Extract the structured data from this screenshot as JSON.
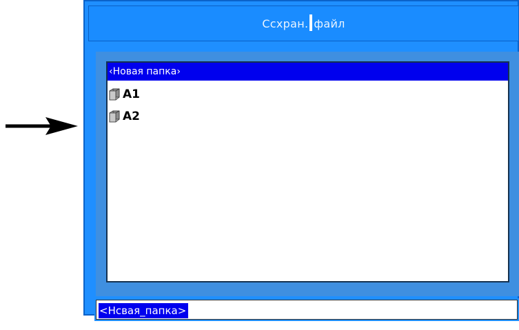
{
  "dialog": {
    "title_part1": "Ссхран.",
    "title_part2": "файл"
  },
  "list": {
    "header": "‹Новая папка›",
    "items": [
      {
        "label": "A1",
        "icon": "folder-icon"
      },
      {
        "label": "A2",
        "icon": "folder-icon"
      }
    ]
  },
  "input": {
    "value": "<Нсвая_папка>"
  },
  "colors": {
    "frame_blue": "#1f8fff",
    "selection_blue": "#0000ee",
    "panel_blue": "#3f8fe0"
  }
}
